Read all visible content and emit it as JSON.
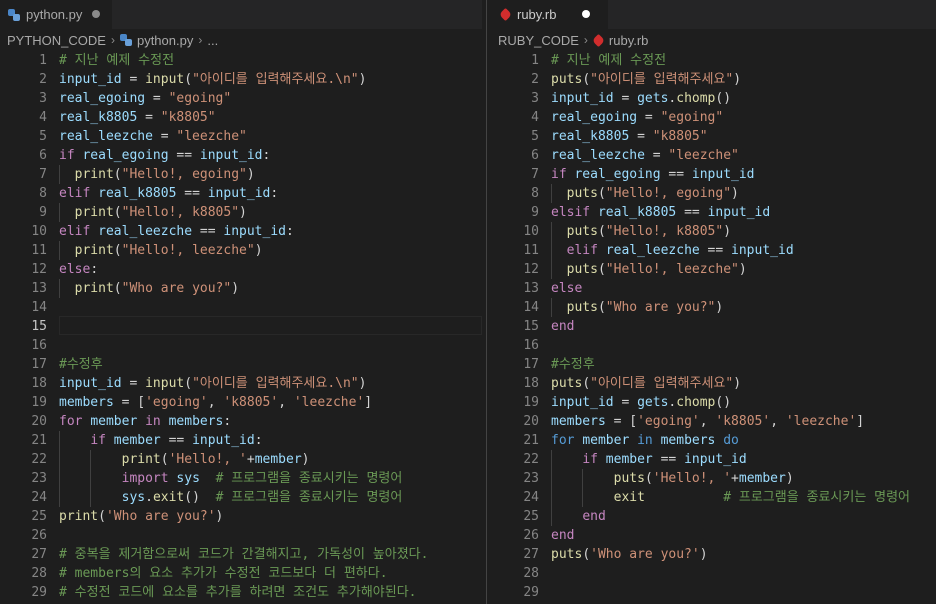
{
  "left": {
    "tab": {
      "filename": "python.py"
    },
    "breadcrumb": {
      "folder": "PYTHON_CODE",
      "file": "python.py",
      "more": "..."
    },
    "active_line": 15,
    "lines": [
      {
        "n": "1",
        "t": [
          [
            "com",
            "# 지난 예제 수정전"
          ]
        ]
      },
      {
        "n": "2",
        "t": [
          [
            "var",
            "input_id"
          ],
          [
            "op",
            " = "
          ],
          [
            "fn",
            "input"
          ],
          [
            "op",
            "("
          ],
          [
            "str",
            "\"아이디를 입력해주세요.\\n\""
          ],
          [
            "op",
            ")"
          ]
        ]
      },
      {
        "n": "3",
        "t": [
          [
            "var",
            "real_egoing"
          ],
          [
            "op",
            " = "
          ],
          [
            "str",
            "\"egoing\""
          ]
        ]
      },
      {
        "n": "4",
        "t": [
          [
            "var",
            "real_k8805"
          ],
          [
            "op",
            " = "
          ],
          [
            "str",
            "\"k8805\""
          ]
        ]
      },
      {
        "n": "5",
        "t": [
          [
            "var",
            "real_leezche"
          ],
          [
            "op",
            " = "
          ],
          [
            "str",
            "\"leezche\""
          ]
        ]
      },
      {
        "n": "6",
        "t": [
          [
            "kw",
            "if "
          ],
          [
            "var",
            "real_egoing"
          ],
          [
            "op",
            " == "
          ],
          [
            "var",
            "input_id"
          ],
          [
            "op",
            ":"
          ]
        ]
      },
      {
        "n": "7",
        "t": [
          [
            "op",
            "  "
          ],
          [
            "fn",
            "print"
          ],
          [
            "op",
            "("
          ],
          [
            "str",
            "\"Hello!, egoing\""
          ],
          [
            "op",
            ")"
          ]
        ]
      },
      {
        "n": "8",
        "t": [
          [
            "kw",
            "elif "
          ],
          [
            "var",
            "real_k8805"
          ],
          [
            "op",
            " == "
          ],
          [
            "var",
            "input_id"
          ],
          [
            "op",
            ":"
          ]
        ]
      },
      {
        "n": "9",
        "t": [
          [
            "op",
            "  "
          ],
          [
            "fn",
            "print"
          ],
          [
            "op",
            "("
          ],
          [
            "str",
            "\"Hello!, k8805\""
          ],
          [
            "op",
            ")"
          ]
        ]
      },
      {
        "n": "10",
        "t": [
          [
            "kw",
            "elif "
          ],
          [
            "var",
            "real_leezche"
          ],
          [
            "op",
            " == "
          ],
          [
            "var",
            "input_id"
          ],
          [
            "op",
            ":"
          ]
        ]
      },
      {
        "n": "11",
        "t": [
          [
            "op",
            "  "
          ],
          [
            "fn",
            "print"
          ],
          [
            "op",
            "("
          ],
          [
            "str",
            "\"Hello!, leezche\""
          ],
          [
            "op",
            ")"
          ]
        ]
      },
      {
        "n": "12",
        "t": [
          [
            "kw",
            "else"
          ],
          [
            "op",
            ":"
          ]
        ]
      },
      {
        "n": "13",
        "t": [
          [
            "op",
            "  "
          ],
          [
            "fn",
            "print"
          ],
          [
            "op",
            "("
          ],
          [
            "str",
            "\"Who are you?\""
          ],
          [
            "op",
            ")"
          ]
        ]
      },
      {
        "n": "14",
        "t": []
      },
      {
        "n": "15",
        "t": []
      },
      {
        "n": "16",
        "t": []
      },
      {
        "n": "17",
        "t": [
          [
            "com",
            "#수정후"
          ]
        ]
      },
      {
        "n": "18",
        "t": [
          [
            "var",
            "input_id"
          ],
          [
            "op",
            " = "
          ],
          [
            "fn",
            "input"
          ],
          [
            "op",
            "("
          ],
          [
            "str",
            "\"아이디를 입력해주세요.\\n\""
          ],
          [
            "op",
            ")"
          ]
        ]
      },
      {
        "n": "19",
        "t": [
          [
            "var",
            "members"
          ],
          [
            "op",
            " = ["
          ],
          [
            "str",
            "'egoing'"
          ],
          [
            "op",
            ", "
          ],
          [
            "str",
            "'k8805'"
          ],
          [
            "op",
            ", "
          ],
          [
            "str",
            "'leezche'"
          ],
          [
            "op",
            "]"
          ]
        ]
      },
      {
        "n": "20",
        "t": [
          [
            "kw",
            "for "
          ],
          [
            "var",
            "member"
          ],
          [
            "kw",
            " in "
          ],
          [
            "var",
            "members"
          ],
          [
            "op",
            ":"
          ]
        ]
      },
      {
        "n": "21",
        "t": [
          [
            "op",
            "    "
          ],
          [
            "kw",
            "if "
          ],
          [
            "var",
            "member"
          ],
          [
            "op",
            " == "
          ],
          [
            "var",
            "input_id"
          ],
          [
            "op",
            ":"
          ]
        ]
      },
      {
        "n": "22",
        "t": [
          [
            "op",
            "        "
          ],
          [
            "fn",
            "print"
          ],
          [
            "op",
            "("
          ],
          [
            "str",
            "'Hello!, '"
          ],
          [
            "op",
            "+"
          ],
          [
            "var",
            "member"
          ],
          [
            "op",
            ")"
          ]
        ]
      },
      {
        "n": "23",
        "t": [
          [
            "op",
            "        "
          ],
          [
            "kw",
            "import "
          ],
          [
            "var",
            "sys"
          ],
          [
            "op",
            "  "
          ],
          [
            "com",
            "# 프로그램을 종료시키는 명령어"
          ]
        ]
      },
      {
        "n": "24",
        "t": [
          [
            "op",
            "        "
          ],
          [
            "var",
            "sys"
          ],
          [
            "op",
            "."
          ],
          [
            "fn",
            "exit"
          ],
          [
            "op",
            "()  "
          ],
          [
            "com",
            "# 프로그램을 종료시키는 명령어"
          ]
        ]
      },
      {
        "n": "25",
        "t": [
          [
            "fn",
            "print"
          ],
          [
            "op",
            "("
          ],
          [
            "str",
            "'Who are you?'"
          ],
          [
            "op",
            ")"
          ]
        ]
      },
      {
        "n": "26",
        "t": []
      },
      {
        "n": "27",
        "t": [
          [
            "com",
            "# 중복을 제거함으로써 코드가 간결해지고, 가독성이 높아졌다."
          ]
        ]
      },
      {
        "n": "28",
        "t": [
          [
            "com",
            "# members의 요소 추가가 수정전 코드보다 더 편하다."
          ]
        ]
      },
      {
        "n": "29",
        "t": [
          [
            "com",
            "# 수정전 코드에 요소를 추가를 하려면 조건도 추가해야된다."
          ]
        ]
      }
    ]
  },
  "right": {
    "tab": {
      "filename": "ruby.rb"
    },
    "breadcrumb": {
      "folder": "RUBY_CODE",
      "file": "ruby.rb"
    },
    "lines": [
      {
        "n": "1",
        "t": [
          [
            "com",
            "# 지난 예제 수정전"
          ]
        ]
      },
      {
        "n": "2",
        "t": [
          [
            "fn",
            "puts"
          ],
          [
            "op",
            "("
          ],
          [
            "str",
            "\"아이디를 입력해주세요\""
          ],
          [
            "op",
            ")"
          ]
        ]
      },
      {
        "n": "3",
        "t": [
          [
            "var",
            "input_id"
          ],
          [
            "op",
            " = "
          ],
          [
            "var",
            "gets"
          ],
          [
            "op",
            "."
          ],
          [
            "fn",
            "chomp"
          ],
          [
            "op",
            "()"
          ]
        ]
      },
      {
        "n": "4",
        "t": [
          [
            "var",
            "real_egoing"
          ],
          [
            "op",
            " = "
          ],
          [
            "str",
            "\"egoing\""
          ]
        ]
      },
      {
        "n": "5",
        "t": [
          [
            "var",
            "real_k8805"
          ],
          [
            "op",
            " = "
          ],
          [
            "str",
            "\"k8805\""
          ]
        ]
      },
      {
        "n": "6",
        "t": [
          [
            "var",
            "real_leezche"
          ],
          [
            "op",
            " = "
          ],
          [
            "str",
            "\"leezche\""
          ]
        ]
      },
      {
        "n": "7",
        "t": [
          [
            "kw",
            "if "
          ],
          [
            "var",
            "real_egoing"
          ],
          [
            "op",
            " == "
          ],
          [
            "var",
            "input_id"
          ]
        ]
      },
      {
        "n": "8",
        "t": [
          [
            "op",
            "  "
          ],
          [
            "fn",
            "puts"
          ],
          [
            "op",
            "("
          ],
          [
            "str",
            "\"Hello!, egoing\""
          ],
          [
            "op",
            ")"
          ]
        ]
      },
      {
        "n": "9",
        "t": [
          [
            "kw",
            "elsif "
          ],
          [
            "var",
            "real_k8805"
          ],
          [
            "op",
            " == "
          ],
          [
            "var",
            "input_id"
          ]
        ]
      },
      {
        "n": "10",
        "t": [
          [
            "op",
            "  "
          ],
          [
            "fn",
            "puts"
          ],
          [
            "op",
            "("
          ],
          [
            "str",
            "\"Hello!, k8805\""
          ],
          [
            "op",
            ")"
          ]
        ]
      },
      {
        "n": "11",
        "t": [
          [
            "op",
            "  "
          ],
          [
            "kw",
            "elif "
          ],
          [
            "var",
            "real_leezche"
          ],
          [
            "op",
            " == "
          ],
          [
            "var",
            "input_id"
          ]
        ]
      },
      {
        "n": "12",
        "t": [
          [
            "op",
            "  "
          ],
          [
            "fn",
            "puts"
          ],
          [
            "op",
            "("
          ],
          [
            "str",
            "\"Hello!, leezche\""
          ],
          [
            "op",
            ")"
          ]
        ]
      },
      {
        "n": "13",
        "t": [
          [
            "kw",
            "else"
          ]
        ]
      },
      {
        "n": "14",
        "t": [
          [
            "op",
            "  "
          ],
          [
            "fn",
            "puts"
          ],
          [
            "op",
            "("
          ],
          [
            "str",
            "\"Who are you?\""
          ],
          [
            "op",
            ")"
          ]
        ]
      },
      {
        "n": "15",
        "t": [
          [
            "kw",
            "end"
          ]
        ]
      },
      {
        "n": "16",
        "t": []
      },
      {
        "n": "17",
        "t": [
          [
            "com",
            "#수정후"
          ]
        ]
      },
      {
        "n": "18",
        "t": [
          [
            "fn",
            "puts"
          ],
          [
            "op",
            "("
          ],
          [
            "str",
            "\"아이디를 입력해주세요\""
          ],
          [
            "op",
            ")"
          ]
        ]
      },
      {
        "n": "19",
        "t": [
          [
            "var",
            "input_id"
          ],
          [
            "op",
            " = "
          ],
          [
            "var",
            "gets"
          ],
          [
            "op",
            "."
          ],
          [
            "fn",
            "chomp"
          ],
          [
            "op",
            "()"
          ]
        ]
      },
      {
        "n": "20",
        "t": [
          [
            "var",
            "members"
          ],
          [
            "op",
            " = ["
          ],
          [
            "str",
            "'egoing'"
          ],
          [
            "op",
            ", "
          ],
          [
            "str",
            "'k8805'"
          ],
          [
            "op",
            ", "
          ],
          [
            "str",
            "'leezche'"
          ],
          [
            "op",
            "]"
          ]
        ]
      },
      {
        "n": "21",
        "t": [
          [
            "kw2",
            "for "
          ],
          [
            "var",
            "member"
          ],
          [
            "kw2",
            " in "
          ],
          [
            "var",
            "members"
          ],
          [
            "kw2",
            " do"
          ]
        ]
      },
      {
        "n": "22",
        "t": [
          [
            "op",
            "    "
          ],
          [
            "kw",
            "if "
          ],
          [
            "var",
            "member"
          ],
          [
            "op",
            " == "
          ],
          [
            "var",
            "input_id"
          ]
        ]
      },
      {
        "n": "23",
        "t": [
          [
            "op",
            "        "
          ],
          [
            "fn",
            "puts"
          ],
          [
            "op",
            "("
          ],
          [
            "str",
            "'Hello!, '"
          ],
          [
            "op",
            "+"
          ],
          [
            "var",
            "member"
          ],
          [
            "op",
            ")"
          ]
        ]
      },
      {
        "n": "24",
        "t": [
          [
            "op",
            "        "
          ],
          [
            "fn",
            "exit"
          ],
          [
            "op",
            "          "
          ],
          [
            "com",
            "# 프로그램을 종료시키는 명령어"
          ]
        ]
      },
      {
        "n": "25",
        "t": [
          [
            "op",
            "    "
          ],
          [
            "kw",
            "end"
          ]
        ]
      },
      {
        "n": "26",
        "t": [
          [
            "kw",
            "end"
          ]
        ]
      },
      {
        "n": "27",
        "t": [
          [
            "fn",
            "puts"
          ],
          [
            "op",
            "("
          ],
          [
            "str",
            "'Who are you?'"
          ],
          [
            "op",
            ")"
          ]
        ]
      },
      {
        "n": "28",
        "t": []
      },
      {
        "n": "29",
        "t": []
      }
    ]
  }
}
